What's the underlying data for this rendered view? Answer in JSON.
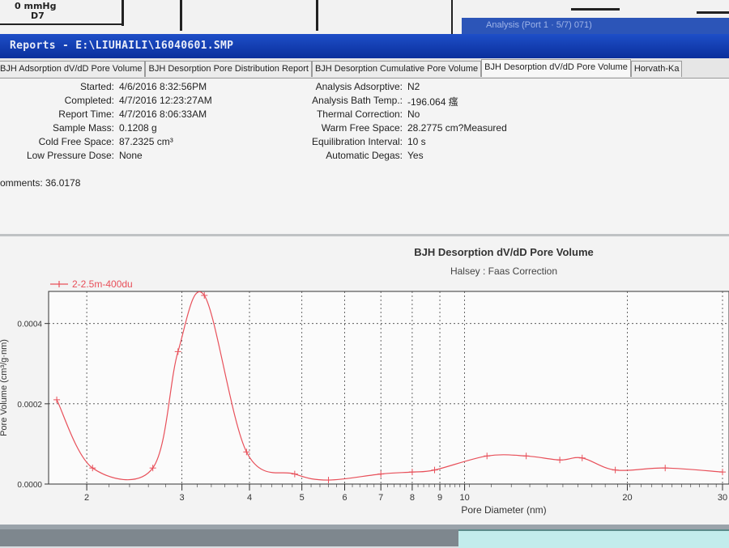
{
  "background_window": {
    "pressure_label": "0 mmHg",
    "port_label": "D7",
    "right_window_title": "Analysis (Port 1 · 5/7) 071)"
  },
  "window": {
    "title": "Reports - E:\\LIUHAILI\\16040601.SMP"
  },
  "tabs": [
    {
      "label": "BJH Adsorption dV/dD Pore Volume",
      "active": false
    },
    {
      "label": "BJH Desorption Pore Distribution Report",
      "active": false
    },
    {
      "label": "BJH Desorption Cumulative Pore Volume",
      "active": false
    },
    {
      "label": "BJH Desorption dV/dD Pore Volume",
      "active": true
    },
    {
      "label": "Horvath-Ka",
      "active": false
    }
  ],
  "report_info": {
    "left": [
      {
        "label": "Started:",
        "value": "4/6/2016 8:32:56PM"
      },
      {
        "label": "Completed:",
        "value": "4/7/2016 12:23:27AM"
      },
      {
        "label": "Report Time:",
        "value": "4/7/2016 8:06:33AM"
      },
      {
        "label": "Sample Mass:",
        "value": "0.1208 g"
      },
      {
        "label": "Cold Free Space:",
        "value": "87.2325 cm³"
      },
      {
        "label": "Low Pressure Dose:",
        "value": "None"
      }
    ],
    "right": [
      {
        "label": "Analysis Adsorptive:",
        "value": "N2"
      },
      {
        "label": "Analysis Bath Temp.:",
        "value": "-196.064 瘙"
      },
      {
        "label": "Thermal Correction:",
        "value": "No"
      },
      {
        "label": "Warm Free Space:",
        "value": "28.2775 cm?Measured"
      },
      {
        "label": "Equilibration Interval:",
        "value": "10 s"
      },
      {
        "label": "Automatic Degas:",
        "value": "Yes"
      }
    ],
    "comments": "omments: 36.0178"
  },
  "chart_data": {
    "type": "line",
    "title": "BJH Desorption dV/dD Pore Volume",
    "subtitle": "Halsey : Faas Correction",
    "xlabel": "Pore Diameter (nm)",
    "ylabel": "Pore Volume (cm³/g·nm)",
    "x_scale": "log",
    "xlim": [
      1.7,
      30
    ],
    "ylim": [
      0,
      0.00048
    ],
    "x_ticks": [
      2,
      3,
      4,
      5,
      6,
      7,
      8,
      9,
      10,
      20,
      30
    ],
    "y_ticks": [
      "0.0000",
      "0.0002",
      "0.0004"
    ],
    "y_tick_values": [
      0,
      0.0002,
      0.0004
    ],
    "grid": true,
    "legend_position": "top-left",
    "series": [
      {
        "name": "2-2.5m-400du",
        "color": "#e8505a",
        "x": [
          1.76,
          2.05,
          2.65,
          2.95,
          3.3,
          3.95,
          4.85,
          5.6,
          7.0,
          8.0,
          8.8,
          11.0,
          13.0,
          15.0,
          16.5,
          19.0,
          23.5,
          30.0
        ],
        "y": [
          0.00021,
          4e-05,
          4e-05,
          0.00033,
          0.00047,
          8e-05,
          2.5e-05,
          1e-05,
          2.5e-05,
          3e-05,
          3.5e-05,
          7e-05,
          7e-05,
          6e-05,
          6.5e-05,
          3.5e-05,
          4e-05,
          3e-05
        ]
      }
    ]
  }
}
